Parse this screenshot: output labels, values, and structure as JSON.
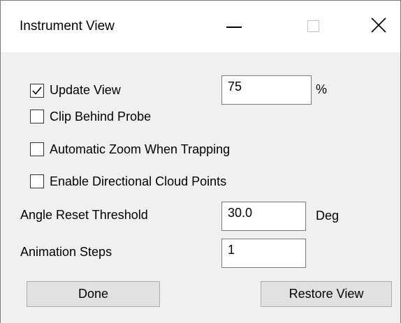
{
  "window": {
    "title": "Instrument View",
    "controls": {
      "minimize_icon": "minimize-icon",
      "maximize_icon": "maximize-icon",
      "close_icon": "close-icon"
    }
  },
  "options": {
    "update_view": {
      "label": "Update View",
      "checked": true,
      "value": "75",
      "unit": "%"
    },
    "clip_behind_probe": {
      "label": "Clip Behind Probe",
      "checked": false
    },
    "automatic_zoom": {
      "label": "Automatic Zoom When Trapping",
      "checked": false
    },
    "directional_cloud_points": {
      "label": "Enable Directional Cloud Points",
      "checked": false
    }
  },
  "angle_reset": {
    "label": "Angle Reset Threshold",
    "value": "30.0",
    "unit": "Deg"
  },
  "animation_steps": {
    "label": "Animation Steps",
    "value": "1"
  },
  "buttons": {
    "done": "Done",
    "restore_view": "Restore View"
  },
  "colors": {
    "dialog_background": "#f0f0f0",
    "titlebar_background": "#ffffff",
    "button_face": "#e1e1e1"
  }
}
